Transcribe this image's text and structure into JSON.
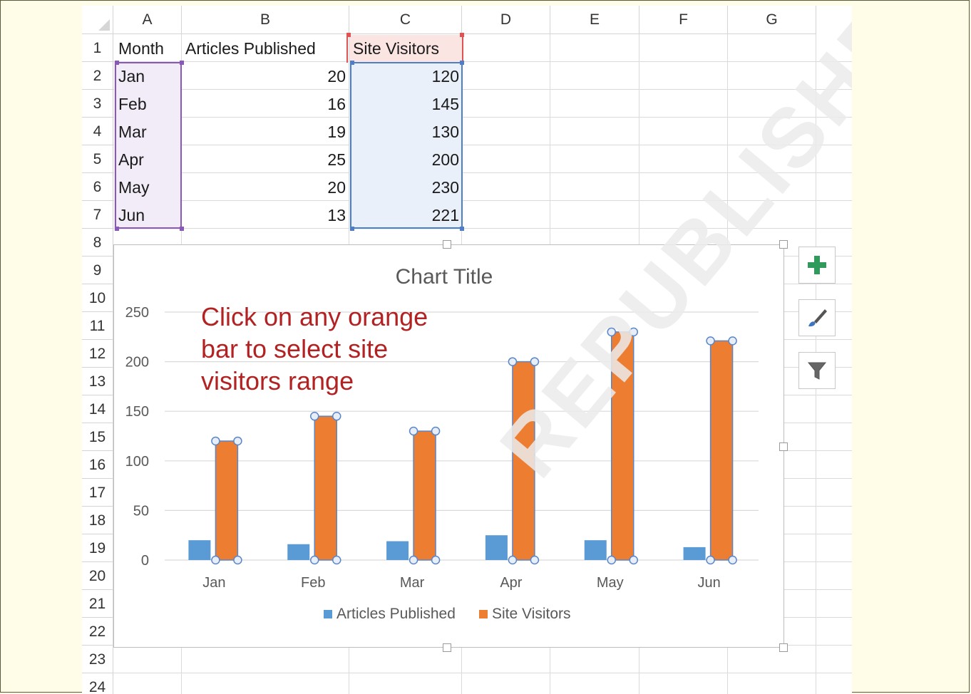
{
  "sheet": {
    "columns": [
      "A",
      "B",
      "C",
      "D",
      "E",
      "F",
      "G"
    ],
    "rows": [
      "1",
      "2",
      "3",
      "4",
      "5",
      "6",
      "7",
      "8",
      "9",
      "10",
      "11",
      "12",
      "13",
      "14",
      "15",
      "16",
      "17",
      "18",
      "19",
      "20",
      "21",
      "22",
      "23",
      "24"
    ],
    "headers": {
      "a": "Month",
      "b": "Articles Published",
      "c": "Site Visitors"
    },
    "data": [
      {
        "month": "Jan",
        "articles": "20",
        "visitors": "120"
      },
      {
        "month": "Feb",
        "articles": "16",
        "visitors": "145"
      },
      {
        "month": "Mar",
        "articles": "19",
        "visitors": "130"
      },
      {
        "month": "Apr",
        "articles": "25",
        "visitors": "200"
      },
      {
        "month": "May",
        "articles": "20",
        "visitors": "230"
      },
      {
        "month": "Jun",
        "articles": "13",
        "visitors": "221"
      }
    ]
  },
  "annotation": {
    "line1": "Click on any orange",
    "line2": "bar to select site",
    "line3": "visitors range",
    "color": "#b22222"
  },
  "chart_buttons": {
    "add": "chart-elements-plus-icon",
    "style": "chart-styles-brush-icon",
    "filter": "chart-filters-funnel-icon"
  },
  "watermark": "REPUBLISHED",
  "chart_data": {
    "type": "bar",
    "title": "Chart Title",
    "categories": [
      "Jan",
      "Feb",
      "Mar",
      "Apr",
      "May",
      "Jun"
    ],
    "series": [
      {
        "name": "Articles Published",
        "values": [
          20,
          16,
          19,
          25,
          20,
          13
        ],
        "color": "#5b9bd5"
      },
      {
        "name": "Site Visitors",
        "values": [
          120,
          145,
          130,
          200,
          230,
          221
        ],
        "color": "#ed7d31"
      }
    ],
    "ylim": [
      0,
      250
    ],
    "yticks": [
      "0",
      "50",
      "100",
      "150",
      "200",
      "250"
    ],
    "grid": true,
    "legend": "bottom",
    "selected_series": "Site Visitors"
  }
}
